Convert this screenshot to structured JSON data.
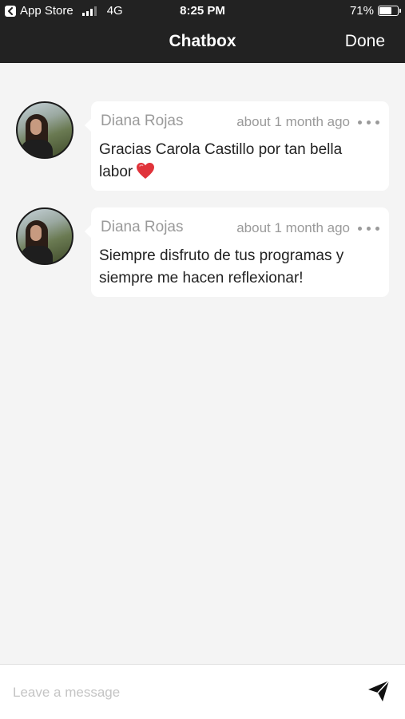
{
  "status_bar": {
    "back_label": "App Store",
    "network": "4G",
    "time": "8:25 PM",
    "battery": "71%",
    "battery_level": 0.71
  },
  "nav": {
    "title": "Chatbox",
    "done_label": "Done"
  },
  "messages": [
    {
      "sender": "Diana Rojas",
      "time": "about 1 month ago",
      "text": "Gracias Carola Castillo por tan bella labor",
      "emoji": "red-heart"
    },
    {
      "sender": "Diana Rojas",
      "time": "about 1 month ago",
      "text": "Siempre disfruto de tus programas y siempre me hacen reflexionar!"
    }
  ],
  "composer": {
    "placeholder": "Leave a message",
    "value": ""
  },
  "icons": {
    "back": "back-arrow-icon",
    "signal": "signal-icon",
    "battery": "battery-icon",
    "more": "more-dots-icon",
    "send": "send-icon"
  },
  "colors": {
    "bar_bg": "#222222",
    "page_bg": "#f4f4f4",
    "bubble_bg": "#ffffff",
    "meta_text": "#9a9a9a",
    "heart": "#e0333a"
  }
}
